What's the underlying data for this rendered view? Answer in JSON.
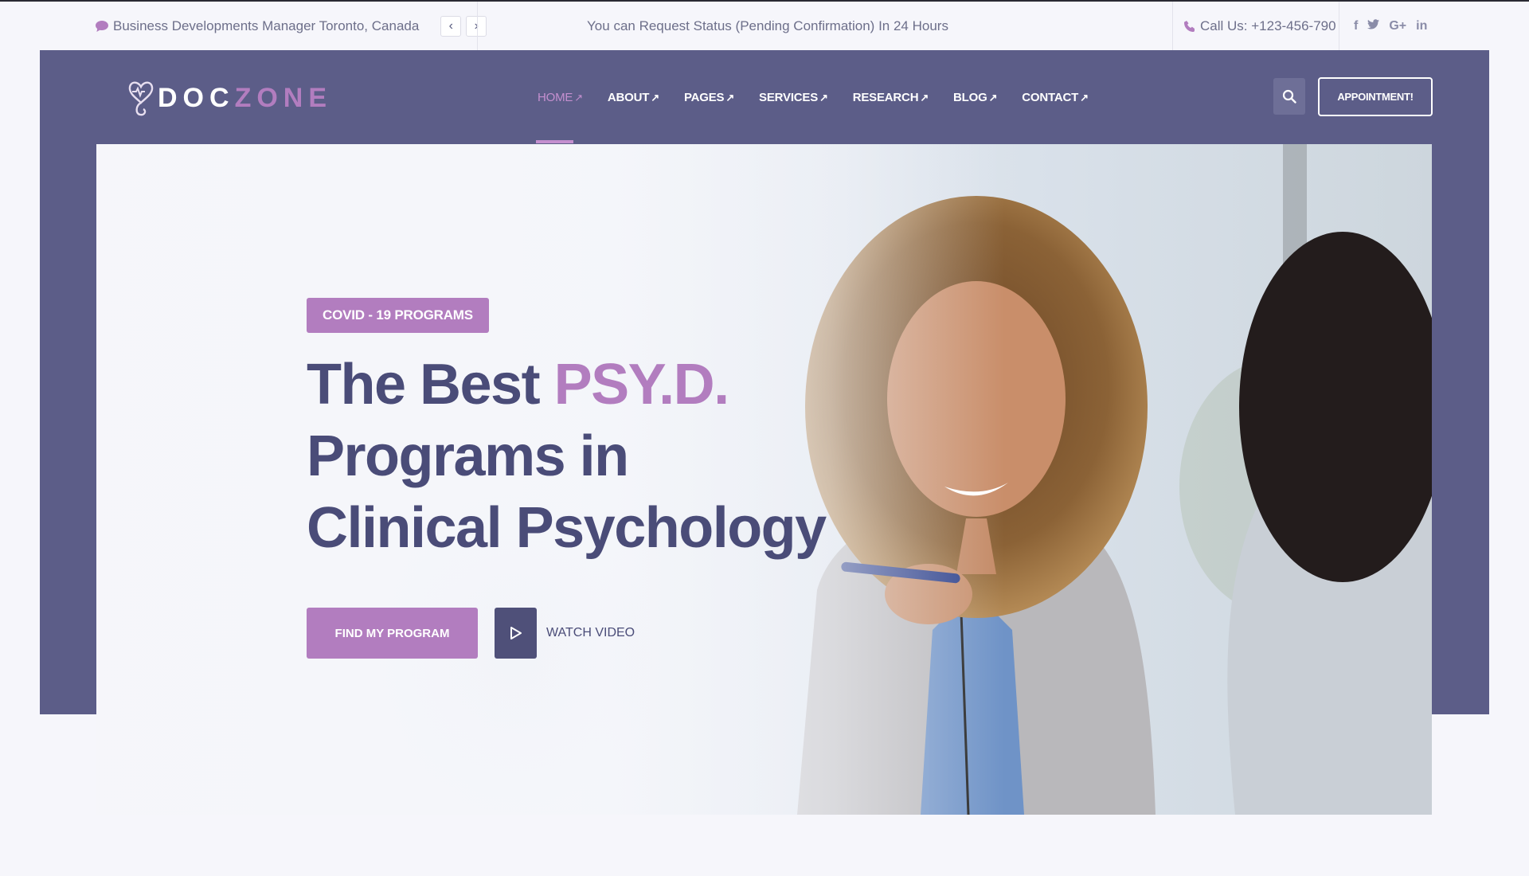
{
  "topbar": {
    "location": "Business Developments Manager Toronto, Canada",
    "notice": "You can Request Status (Pending Confirmation) In 24 Hours",
    "call": "Call Us: +123-456-790",
    "prev": "‹",
    "next": "›",
    "social": [
      "f",
      "t",
      "G+",
      "in"
    ]
  },
  "brand": {
    "part1": "DOC",
    "part2": "ZONE"
  },
  "nav": {
    "items": [
      {
        "label": "HOME",
        "active": true
      },
      {
        "label": "ABOUT"
      },
      {
        "label": "PAGES"
      },
      {
        "label": "SERVICES"
      },
      {
        "label": "RESEARCH"
      },
      {
        "label": "BLOG"
      },
      {
        "label": "CONTACT"
      }
    ],
    "arrow": "↗",
    "appointment": "APPOINTMENT!"
  },
  "hero": {
    "badge": "COVID - 19 PROGRAMS",
    "headline": {
      "line1_prefix": "The Best ",
      "line1_accent": "PSY.D.",
      "line2": "Programs in",
      "line3": "Clinical Psychology"
    },
    "cta": "FIND MY PROGRAM",
    "video": "WATCH VIDEO"
  },
  "colors": {
    "primary": "#5c5d88",
    "accent": "#b27dbf",
    "heading": "#4a4c78",
    "background": "#f6f6fb"
  }
}
